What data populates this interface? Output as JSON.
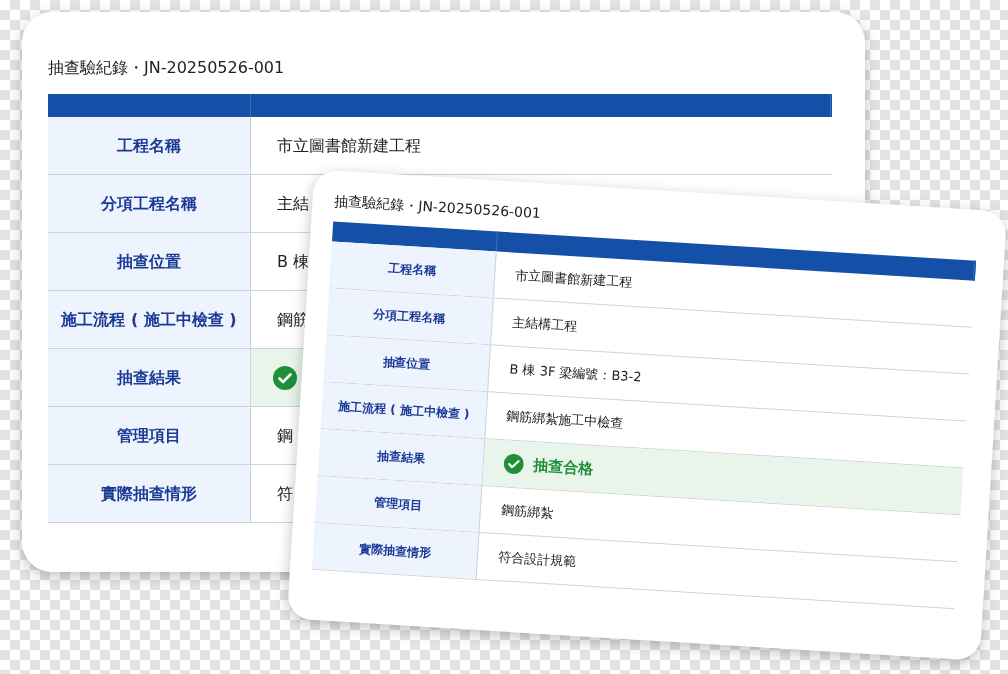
{
  "cards": [
    {
      "title": "抽查驗紀錄・JN-20250526-001",
      "rows": [
        {
          "kind": "text",
          "label": "工程名稱",
          "value": "市立圖書館新建工程"
        },
        {
          "kind": "text",
          "label": "分項工程名稱",
          "value": "主結"
        },
        {
          "kind": "text",
          "label": "抽查位置",
          "value": "B 棟"
        },
        {
          "kind": "text",
          "label": "施工流程 ( 施工中檢查 )",
          "value": "鋼筋"
        },
        {
          "kind": "result",
          "label": "抽查結果"
        },
        {
          "kind": "text",
          "label": "管理項目",
          "value": "鋼"
        },
        {
          "kind": "text",
          "label": "實際抽查情形",
          "value": "符"
        }
      ]
    },
    {
      "title": "抽查驗紀錄・JN-20250526-001",
      "rows": [
        {
          "kind": "text",
          "label": "工程名稱",
          "value": "市立圖書館新建工程"
        },
        {
          "kind": "text",
          "label": "分項工程名稱",
          "value": "主結構工程"
        },
        {
          "kind": "text",
          "label": "抽查位置",
          "value": "B 棟 3F 梁編號：B3-2"
        },
        {
          "kind": "text",
          "label": "施工流程 ( 施工中檢查 )",
          "value": "鋼筋綁紮施工中檢查"
        },
        {
          "kind": "result",
          "label": "抽查結果",
          "value": "抽查合格"
        },
        {
          "kind": "text",
          "label": "管理項目",
          "value": "鋼筋綁紮"
        },
        {
          "kind": "text",
          "label": "實際抽查情形",
          "value": "符合設計規範"
        }
      ]
    }
  ]
}
